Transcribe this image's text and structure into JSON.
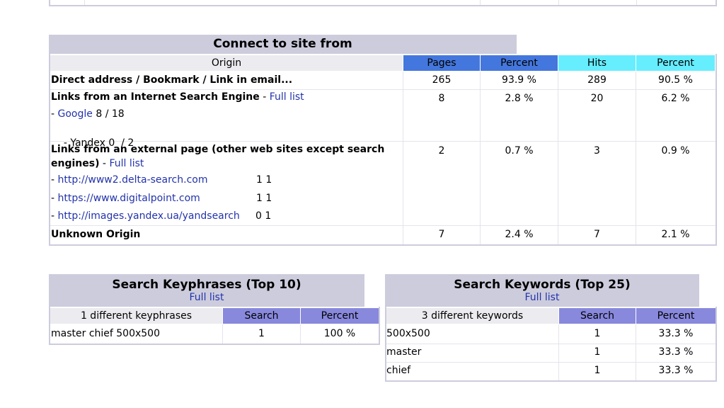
{
  "colors": {
    "title_bg": "#ccccdd",
    "pages": "#4477dd",
    "hits": "#66eeff",
    "search": "#8888dd",
    "header_row": "#ececf0"
  },
  "origin": {
    "title": "Connect to site from",
    "columns": [
      "Origin",
      "Pages",
      "Percent",
      "Hits",
      "Percent"
    ],
    "rows": [
      {
        "label": "Direct address / Bookmark / Link in email...",
        "pages": "265",
        "pages_pct": "93.9 %",
        "hits": "289",
        "hits_pct": "90.5 %"
      },
      {
        "label": "Links from an Internet Search Engine",
        "sep": " - ",
        "link": "Full list",
        "pages": "8",
        "pages_pct": "2.8 %",
        "hits": "20",
        "hits_pct": "6.2 %",
        "subs": [
          {
            "prefix": "- ",
            "name": "Google",
            "suffix": " 8 / 18"
          },
          {
            "prefix": "- Yandex 0  / 2"
          }
        ]
      },
      {
        "label_line1": "Links from an external page (other web sites except search",
        "label_line2": "engines)",
        "sep": " - ",
        "link": "Full list",
        "pages": "2",
        "pages_pct": "0.7 %",
        "hits": "3",
        "hits_pct": "0.9 %",
        "subs": [
          {
            "prefix": "- ",
            "url": "http://www2.delta-search.com",
            "count": "1 1"
          },
          {
            "prefix": "- ",
            "url": "https://www.digitalpoint.com",
            "count": "1 1"
          },
          {
            "prefix": "- ",
            "url": "http://images.yandex.ua/yandsearch",
            "count": "0 1"
          }
        ]
      },
      {
        "label": "Unknown Origin",
        "pages": "7",
        "pages_pct": "2.4 %",
        "hits": "7",
        "hits_pct": "2.1 %"
      }
    ]
  },
  "keyphrases": {
    "title": "Search Keyphrases (Top 10)",
    "link": "Full list",
    "columns": [
      "1 different keyphrases",
      "Search",
      "Percent"
    ],
    "rows": [
      {
        "phrase": "master chief 500x500",
        "search": "1",
        "percent": "100 %"
      }
    ]
  },
  "keywords": {
    "title": "Search Keywords (Top 25)",
    "link": "Full list",
    "columns": [
      "3 different keywords",
      "Search",
      "Percent"
    ],
    "rows": [
      {
        "word": "500x500",
        "search": "1",
        "percent": "33.3 %"
      },
      {
        "word": "master",
        "search": "1",
        "percent": "33.3 %"
      },
      {
        "word": "chief",
        "search": "1",
        "percent": "33.3 %"
      }
    ]
  }
}
